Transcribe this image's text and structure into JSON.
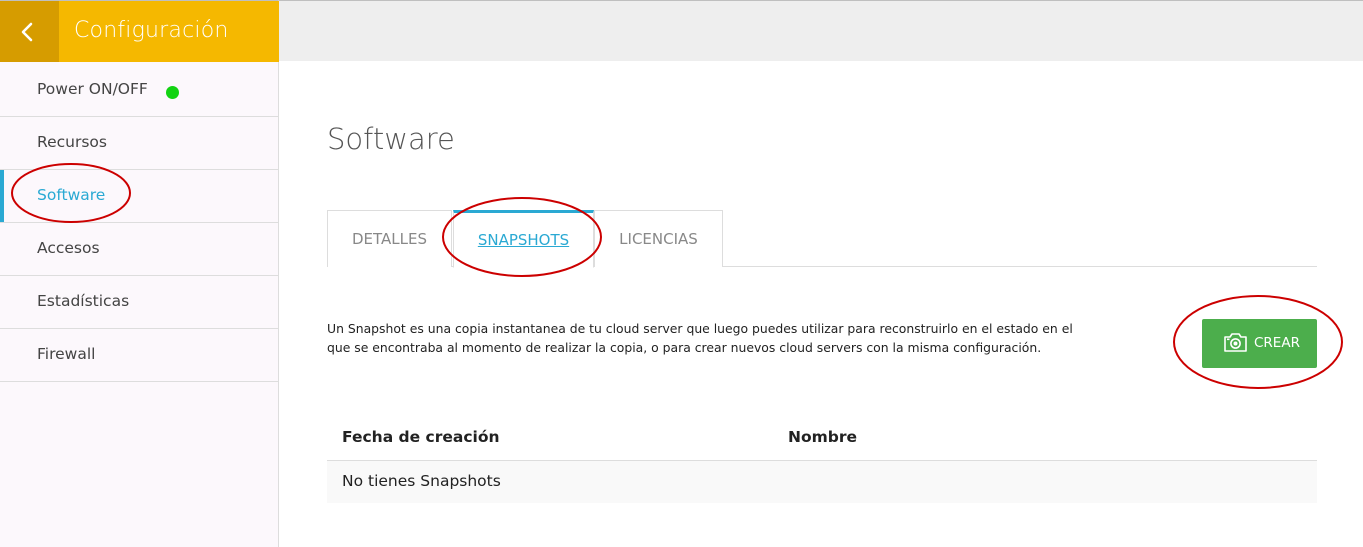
{
  "sidebar": {
    "title": "Configuración",
    "back_icon": "chevron-left-icon",
    "items": [
      {
        "label": "Power ON/OFF",
        "status_color": "#13d313"
      },
      {
        "label": "Recursos"
      },
      {
        "label": "Software",
        "active": true
      },
      {
        "label": "Accesos"
      },
      {
        "label": "Estadísticas"
      },
      {
        "label": "Firewall"
      }
    ]
  },
  "main": {
    "title": "Software",
    "tabs": [
      {
        "label": "DETALLES"
      },
      {
        "label": "SNAPSHOTS",
        "active": true
      },
      {
        "label": "LICENCIAS"
      }
    ],
    "description": "Un Snapshot es una copia instantanea de tu cloud server que luego puedes utilizar para reconstruirlo en el estado en el que se encontraba al momento de realizar la copia, o para crear nuevos cloud servers con la misma configuración.",
    "create_button": {
      "label": "CREAR",
      "icon": "camera-icon",
      "color": "#4cae4c"
    },
    "table": {
      "columns": [
        "Fecha de creación",
        "Nombre"
      ],
      "empty_text": "No tienes Snapshots"
    }
  },
  "colors": {
    "header_yellow": "#f5b800",
    "back_button": "#d69c00",
    "accent_blue": "#2aa9d3",
    "annotation_red": "#cc0000"
  }
}
